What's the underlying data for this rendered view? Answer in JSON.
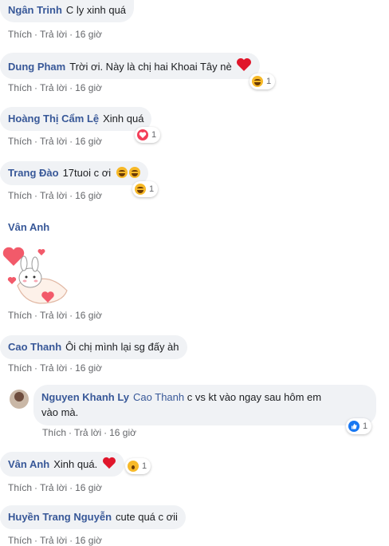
{
  "actions": {
    "like": "Thích",
    "reply": "Trả lời",
    "sep": "·"
  },
  "comments": [
    {
      "author": "Ngân Trinh",
      "text": "C ly xinh quá",
      "time": "16 giờ"
    },
    {
      "author": "Dung Pham",
      "text": "Trời ơi. Này là chị hai Khoai Tây nè",
      "time": "16 giờ",
      "reaction_count": "1"
    },
    {
      "author": "Hoàng Thị Cẩm Lệ",
      "text": "Xinh quá",
      "time": "16 giờ",
      "reaction_count": "1"
    },
    {
      "author": "Trang Đào",
      "text": "17tuoi c ơi",
      "time": "16 giờ",
      "reaction_count": "1"
    },
    {
      "author": "Vân Anh",
      "time": "16 giờ"
    },
    {
      "author": "Cao Thanh",
      "text": "Ôi chị mình lại sg đấy àh",
      "time": "16 giờ"
    },
    {
      "author": "Nguyen Khanh Ly",
      "mention": "Cao Thanh",
      "text_line1": "c vs kt vào ngay sau hôm em",
      "text_line2": "vào mà.",
      "time": "16 giờ",
      "reaction_count": "1"
    },
    {
      "author": "Vân Anh",
      "text": "Xinh quá.",
      "time": "16 giờ",
      "reaction_count": "1"
    },
    {
      "author": "Huyền Trang Nguyễn",
      "text": "cute quá c ơii",
      "time": "16 giờ"
    }
  ],
  "colors": {
    "name": "#385898",
    "bubble": "#f0f2f5",
    "meta": "#65676b",
    "love": "#f33e58",
    "like": "#1877f2",
    "haha": "#f7b928"
  },
  "icons": [
    "heart-icon",
    "laughing-emoji-icon",
    "love-reaction-icon",
    "haha-reaction-icon",
    "like-reaction-icon",
    "wow-reaction-icon",
    "bunny-heart-sticker"
  ]
}
